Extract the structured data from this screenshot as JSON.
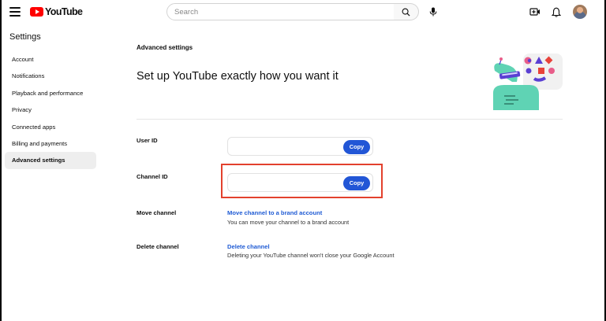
{
  "header": {
    "logo_text": "YouTube",
    "search_placeholder": "Search",
    "search_value": "",
    "icons": [
      "menu-icon",
      "youtube-logo-icon",
      "search-icon",
      "microphone-icon",
      "create-video-icon",
      "bell-icon",
      "avatar"
    ]
  },
  "sidebar": {
    "title": "Settings",
    "items": [
      {
        "label": "Account"
      },
      {
        "label": "Notifications"
      },
      {
        "label": "Playback and performance"
      },
      {
        "label": "Privacy"
      },
      {
        "label": "Connected apps"
      },
      {
        "label": "Billing and payments"
      },
      {
        "label": "Advanced settings",
        "active": true
      }
    ]
  },
  "main": {
    "section_label": "Advanced settings",
    "headline": "Set up YouTube exactly how you want it",
    "rows": {
      "user_id": {
        "label": "User ID",
        "value": "",
        "button": "Copy"
      },
      "channel_id": {
        "label": "Channel ID",
        "value": "",
        "button": "Copy"
      },
      "move_channel": {
        "label": "Move channel",
        "link": "Move channel to a brand account",
        "description": "You can move your channel to a brand account"
      },
      "delete_channel": {
        "label": "Delete channel",
        "link": "Delete channel",
        "description": "Deleting your YouTube channel won't close your Google Account"
      }
    }
  },
  "colors": {
    "accent_button": "#2256d6",
    "link": "#1f5bd4",
    "highlight_box": "#e3412d",
    "logo_red": "#ff0000",
    "active_item_bg": "#eeeeee"
  }
}
